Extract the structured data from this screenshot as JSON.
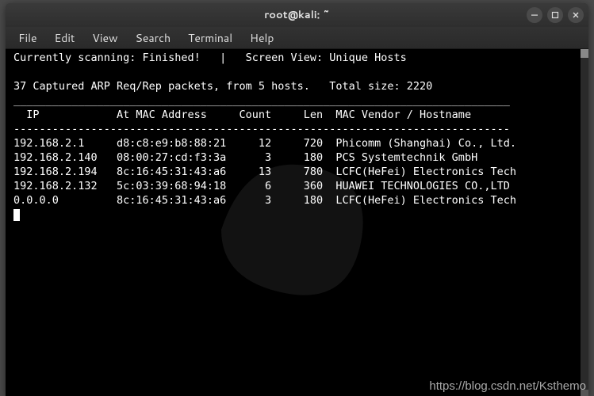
{
  "window": {
    "title": "root@kali: ~"
  },
  "menu": {
    "file": "File",
    "edit": "Edit",
    "view": "View",
    "search": "Search",
    "terminal": "Terminal",
    "help": "Help"
  },
  "terminal": {
    "line1": "Currently scanning: Finished!   |   Screen View: Unique Hosts",
    "line2": "",
    "line3": "37 Captured ARP Req/Rep packets, from 5 hosts.   Total size: 2220",
    "hr1": "_____________________________________________________________________________",
    "header": "  IP            At MAC Address     Count     Len  MAC Vendor / Hostname",
    "hr2": "-----------------------------------------------------------------------------",
    "rows": [
      "192.168.2.1     d8:c8:e9:b8:88:21     12     720  Phicomm (Shanghai) Co., Ltd.",
      "192.168.2.140   08:00:27:cd:f3:3a      3     180  PCS Systemtechnik GmbH",
      "192.168.2.194   8c:16:45:31:43:a6     13     780  LCFC(HeFei) Electronics Tech",
      "192.168.2.132   5c:03:39:68:94:18      6     360  HUAWEI TECHNOLOGIES CO.,LTD",
      "0.0.0.0         8c:16:45:31:43:a6      3     180  LCFC(HeFei) Electronics Tech"
    ]
  },
  "watermark": "https://blog.csdn.net/Ksthemo"
}
